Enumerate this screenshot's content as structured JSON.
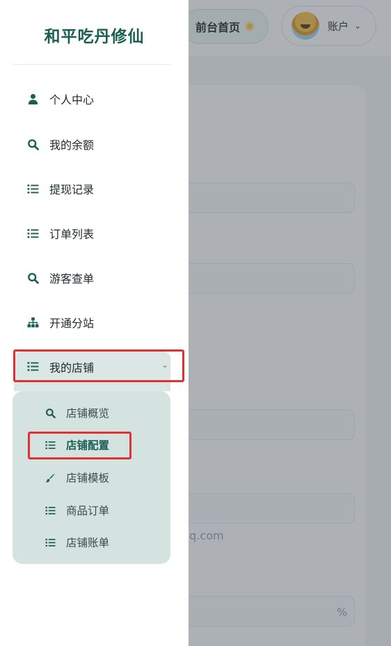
{
  "header": {
    "home_label": "前台首页",
    "account_label": "账户"
  },
  "background": {
    "email_fragment": "qq.com",
    "suffix_percent": "%"
  },
  "drawer": {
    "brand": "和平吃丹修仙",
    "items": [
      {
        "label": "个人中心",
        "icon": "user-icon"
      },
      {
        "label": "我的余额",
        "icon": "search-icon"
      },
      {
        "label": "提现记录",
        "icon": "list-icon"
      },
      {
        "label": "订单列表",
        "icon": "list-icon"
      },
      {
        "label": "游客查单",
        "icon": "search-icon"
      },
      {
        "label": "开通分站",
        "icon": "sitemap-icon"
      },
      {
        "label": "我的店铺",
        "icon": "list-icon",
        "expanded": true
      }
    ],
    "submenu": [
      {
        "label": "店铺概览",
        "icon": "search-icon"
      },
      {
        "label": "店铺配置",
        "icon": "list-icon",
        "active": true
      },
      {
        "label": "店铺模板",
        "icon": "brush-icon"
      },
      {
        "label": "商品订单",
        "icon": "list-icon"
      },
      {
        "label": "店铺账单",
        "icon": "list-icon"
      }
    ]
  },
  "colors": {
    "brand": "#1b5e52",
    "highlight": "#e03131",
    "submenu_bg": "#d4e3e0"
  }
}
